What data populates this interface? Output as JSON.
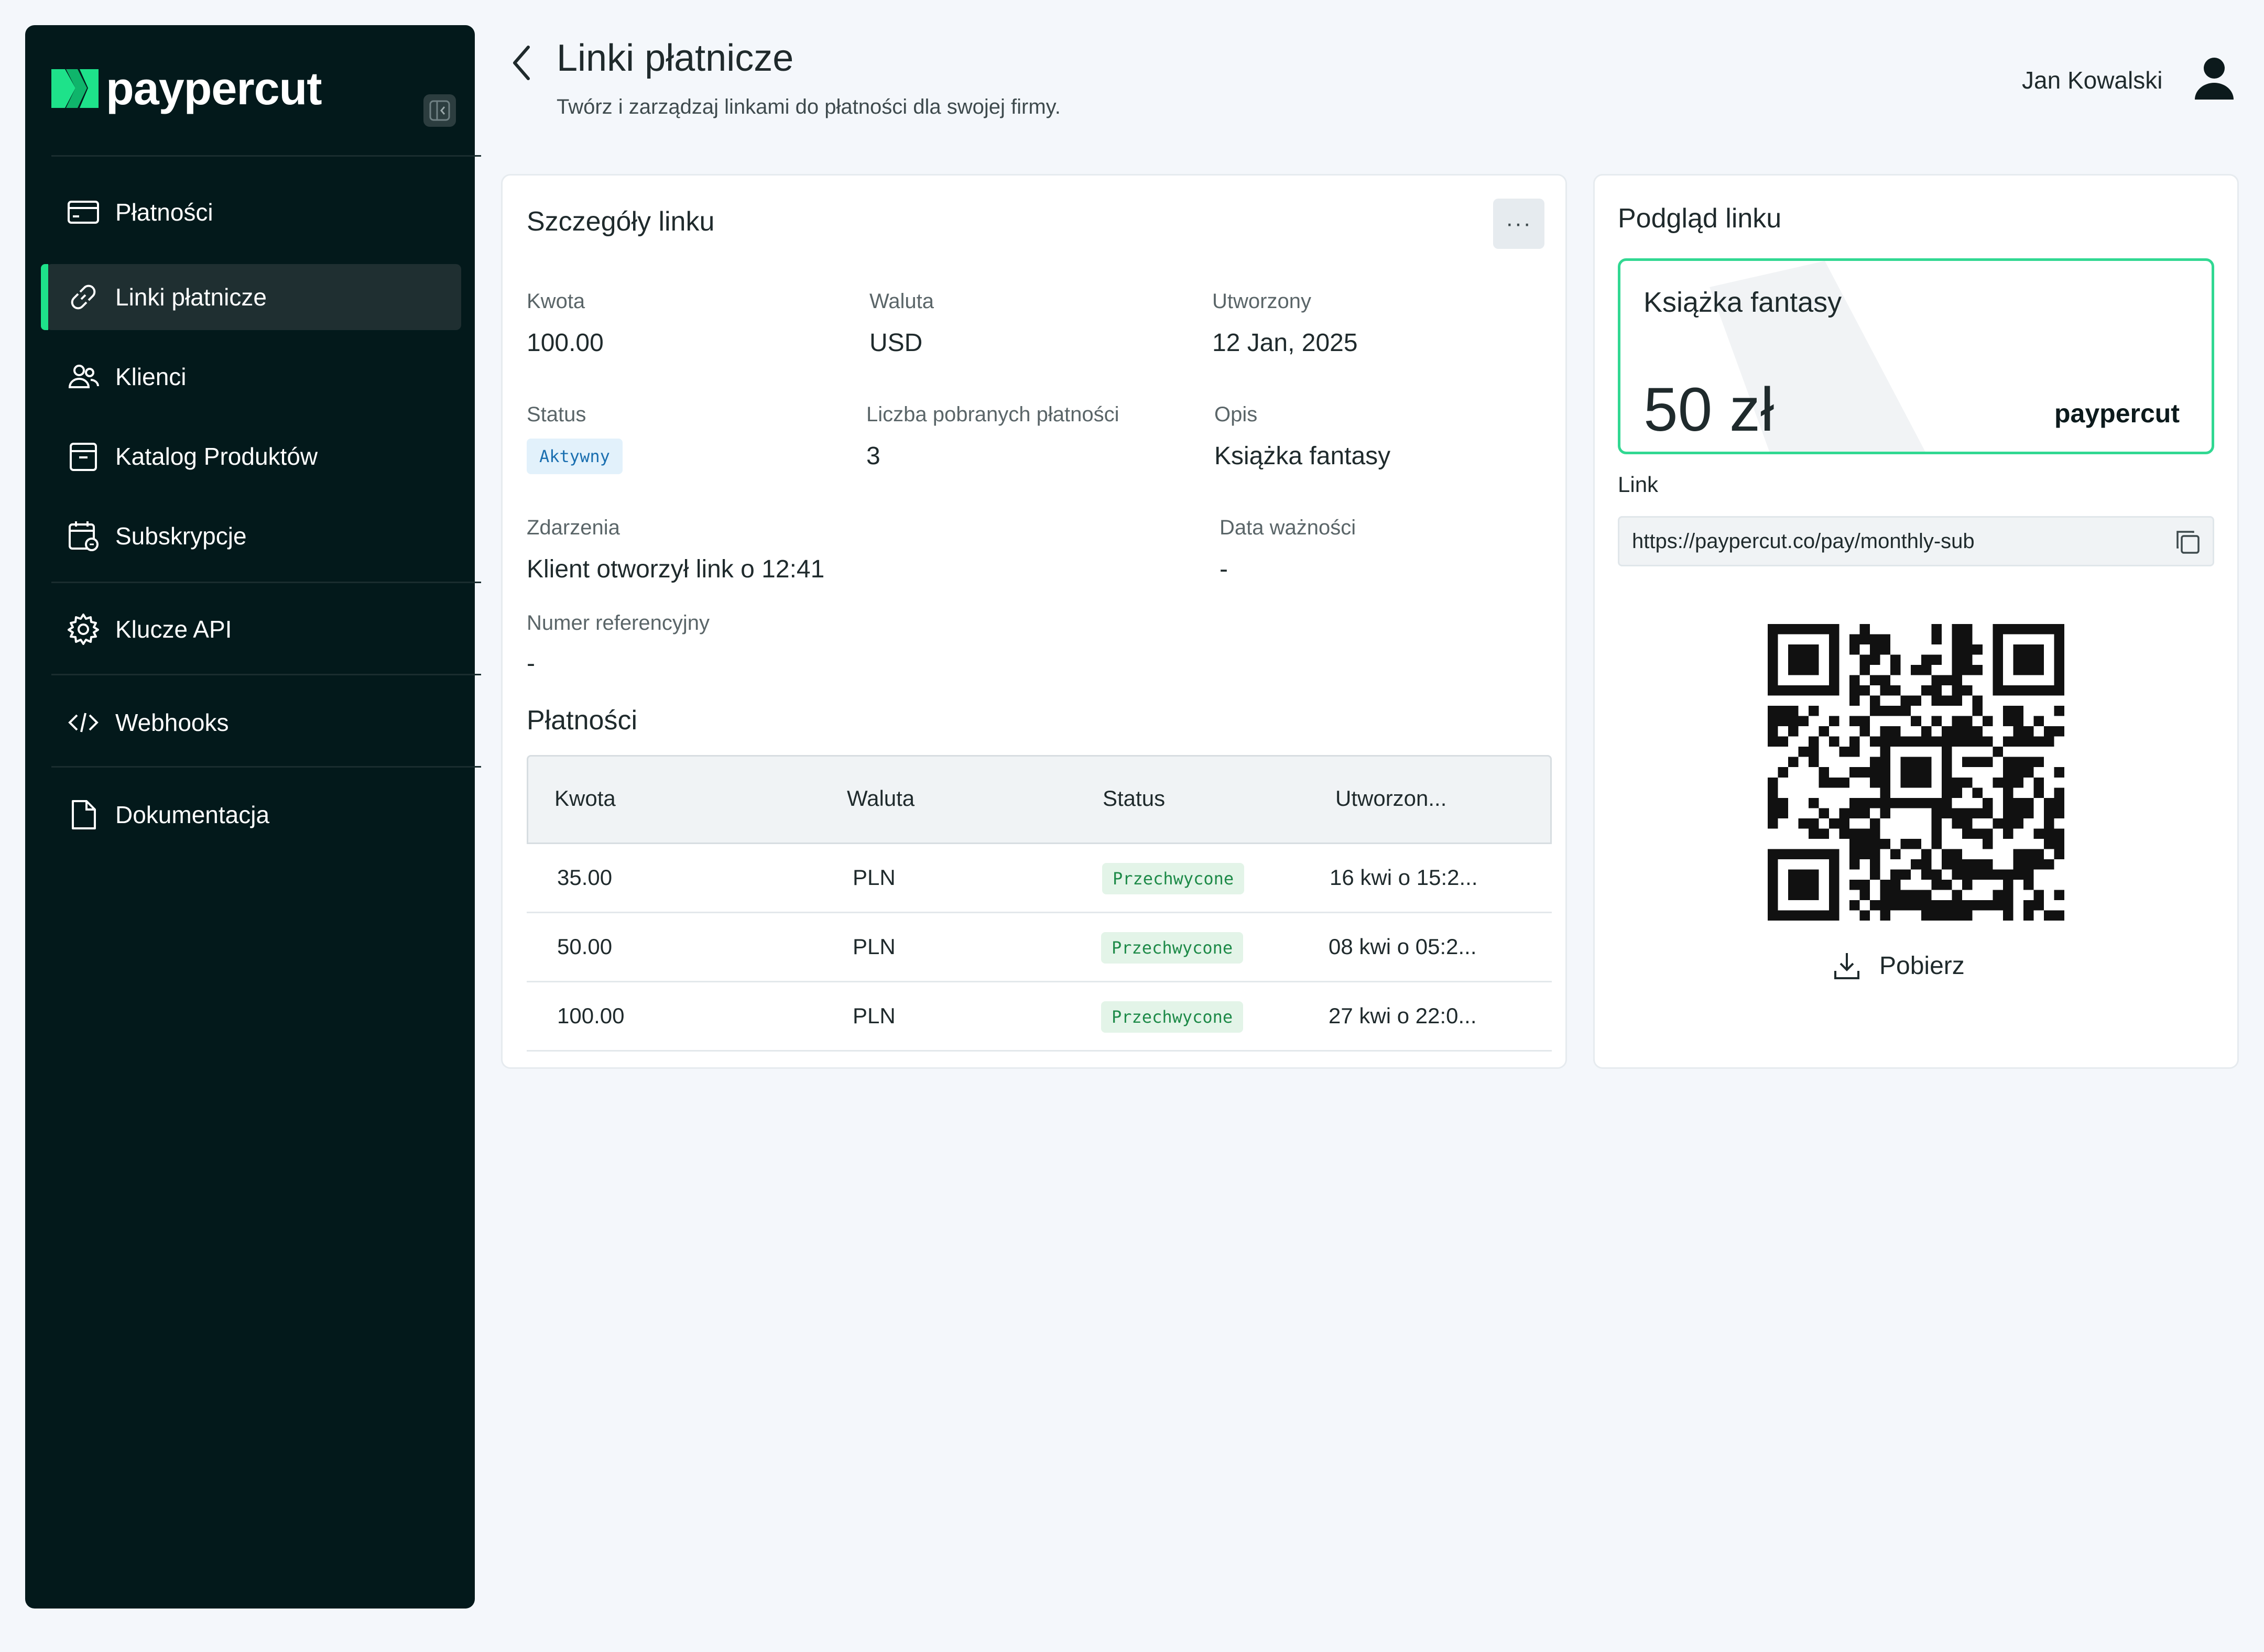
{
  "app": {
    "brand": "paypercut",
    "accent_color": "#1ee28a",
    "sidebar_bg": "#03191b"
  },
  "sidebar": {
    "items": [
      {
        "label": "Płatności",
        "icon": "credit-card-icon",
        "active": false
      },
      {
        "label": "Linki płatnicze",
        "icon": "link-icon",
        "active": true
      },
      {
        "label": "Klienci",
        "icon": "users-icon",
        "active": false
      },
      {
        "label": "Katalog Produktów",
        "icon": "archive-box-icon",
        "active": false
      },
      {
        "label": "Subskrypcje",
        "icon": "calendar-subscription-icon",
        "active": false
      },
      {
        "label": "Klucze API",
        "icon": "gear-icon",
        "active": false
      },
      {
        "label": "Webhooks",
        "icon": "code-icon",
        "active": false
      },
      {
        "label": "Dokumentacja",
        "icon": "document-icon",
        "active": false
      }
    ]
  },
  "header": {
    "title": "Linki płatnicze",
    "subtitle": "Twórz i zarządzaj linkami do płatności dla swojej firmy.",
    "user_name": "Jan Kowalski"
  },
  "details": {
    "title": "Szczegóły linku",
    "more_label": "···",
    "amount_label": "Kwota",
    "amount_value": "100.00",
    "currency_label": "Waluta",
    "currency_value": "USD",
    "created_label": "Utworzony",
    "created_value": "12 Jan, 2025",
    "status_label": "Status",
    "status_value": "Aktywny",
    "payments_count_label": "Liczba pobranych płatności",
    "payments_count_value": "3",
    "description_label": "Opis",
    "description_value": "Książka fantasy",
    "events_label": "Zdarzenia",
    "events_value": "Klient otworzył link o 12:41",
    "expiry_label": "Data ważności",
    "expiry_value": "-",
    "reference_label": "Numer referencyjny",
    "reference_value": "-"
  },
  "payments": {
    "title": "Płatności",
    "columns": [
      "Kwota",
      "Waluta",
      "Status",
      "Utworzon..."
    ],
    "rows": [
      {
        "amount": "35.00",
        "currency": "PLN",
        "status": "Przechwycone",
        "created": "16 kwi o 15:2..."
      },
      {
        "amount": "50.00",
        "currency": "PLN",
        "status": "Przechwycone",
        "created": "08 kwi o 05:2..."
      },
      {
        "amount": "100.00",
        "currency": "PLN",
        "status": "Przechwycone",
        "created": "27 kwi o 22:0..."
      }
    ]
  },
  "preview": {
    "title": "Podgląd linku",
    "product_name": "Książka fantasy",
    "amount": "50 zł",
    "brand": "paypercut",
    "link_label": "Link",
    "link_url": "https://paypercut.co/pay/monthly-sub",
    "download_label": "Pobierz"
  }
}
